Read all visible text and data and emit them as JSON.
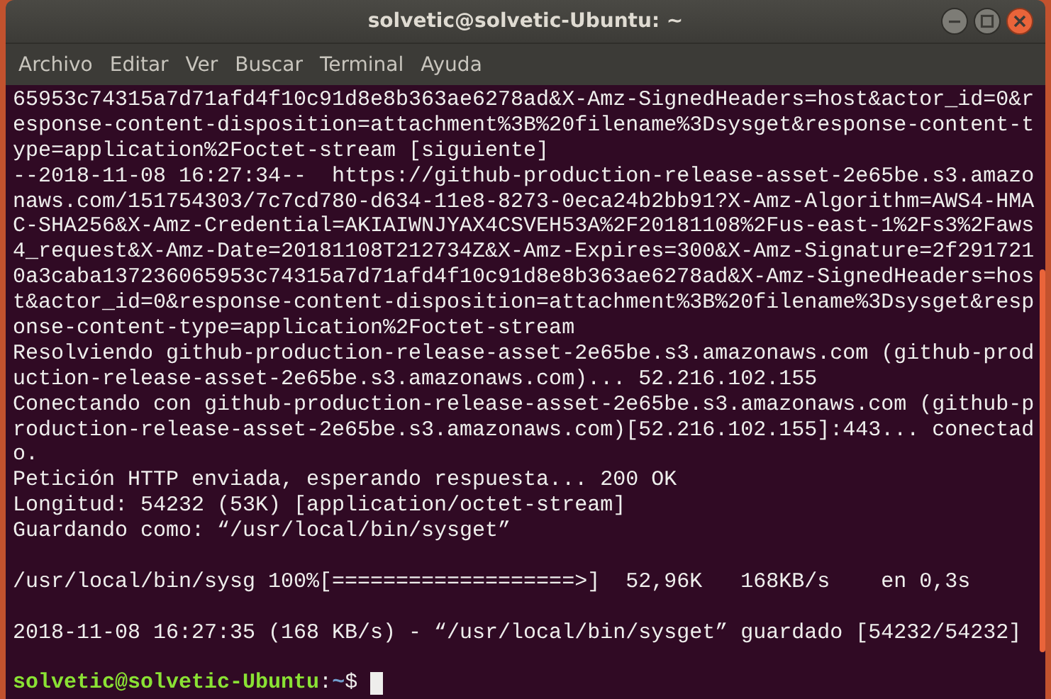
{
  "window": {
    "title": "solvetic@solvetic-Ubuntu: ~"
  },
  "menu": [
    "Archivo",
    "Editar",
    "Ver",
    "Buscar",
    "Terminal",
    "Ayuda"
  ],
  "lines": [
    {
      "kind": "text",
      "text": "65953c74315a7d71afd4f10c91d8e8b363ae6278ad&X-Amz-SignedHeaders=host&actor_id=0&r"
    },
    {
      "kind": "text",
      "text": "esponse-content-disposition=attachment%3B%20filename%3Dsysget&response-content-t"
    },
    {
      "kind": "text",
      "text": "ype=application%2Foctet-stream [siguiente]"
    },
    {
      "kind": "text",
      "text": "--2018-11-08 16:27:34--  https://github-production-release-asset-2e65be.s3.amazo"
    },
    {
      "kind": "text",
      "text": "naws.com/151754303/7c7cd780-d634-11e8-8273-0eca24b2bb91?X-Amz-Algorithm=AWS4-HMA"
    },
    {
      "kind": "text",
      "text": "C-SHA256&X-Amz-Credential=AKIAIWNJYAX4CSVEH53A%2F20181108%2Fus-east-1%2Fs3%2Faws"
    },
    {
      "kind": "text",
      "text": "4_request&X-Amz-Date=20181108T212734Z&X-Amz-Expires=300&X-Amz-Signature=2f291721"
    },
    {
      "kind": "text",
      "text": "0a3caba137236065953c74315a7d71afd4f10c91d8e8b363ae6278ad&X-Amz-SignedHeaders=hos"
    },
    {
      "kind": "text",
      "text": "t&actor_id=0&response-content-disposition=attachment%3B%20filename%3Dsysget&resp"
    },
    {
      "kind": "text",
      "text": "onse-content-type=application%2Foctet-stream"
    },
    {
      "kind": "text",
      "text": "Resolviendo github-production-release-asset-2e65be.s3.amazonaws.com (github-prod"
    },
    {
      "kind": "text",
      "text": "uction-release-asset-2e65be.s3.amazonaws.com)... 52.216.102.155"
    },
    {
      "kind": "text",
      "text": "Conectando con github-production-release-asset-2e65be.s3.amazonaws.com (github-p"
    },
    {
      "kind": "text",
      "text": "roduction-release-asset-2e65be.s3.amazonaws.com)[52.216.102.155]:443... conectad"
    },
    {
      "kind": "text",
      "text": "o."
    },
    {
      "kind": "text",
      "text": "Petición HTTP enviada, esperando respuesta... 200 OK"
    },
    {
      "kind": "text",
      "text": "Longitud: 54232 (53K) [application/octet-stream]"
    },
    {
      "kind": "text",
      "text": "Guardando como: “/usr/local/bin/sysget”"
    },
    {
      "kind": "blank"
    },
    {
      "kind": "text",
      "text": "/usr/local/bin/sysg 100%[===================>]  52,96K   168KB/s    en 0,3s"
    },
    {
      "kind": "blank"
    },
    {
      "kind": "text",
      "text": "2018-11-08 16:27:35 (168 KB/s) - “/usr/local/bin/sysget” guardado [54232/54232]"
    },
    {
      "kind": "blank"
    },
    {
      "kind": "prompt",
      "user": "solvetic@solvetic-Ubuntu",
      "sep": ":",
      "path": "~",
      "symbol": "$"
    }
  ]
}
